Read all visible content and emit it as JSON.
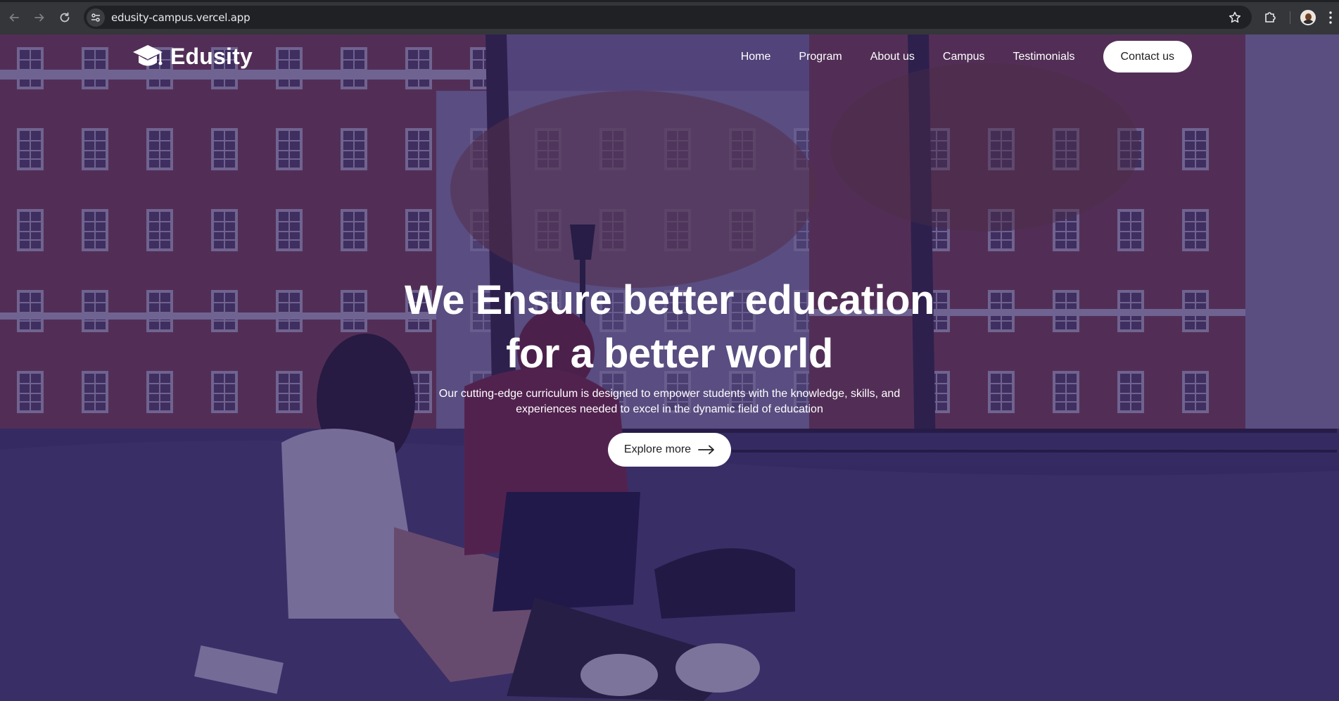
{
  "browser": {
    "url": "edusity-campus.vercel.app",
    "icons": {
      "back": "arrow-left-icon",
      "forward": "arrow-right-icon",
      "reload": "reload-icon",
      "site_info": "tune-icon",
      "bookmark": "star-icon",
      "extensions": "puzzle-icon",
      "profile": "avatar",
      "menu": "kebab-menu-icon"
    }
  },
  "site": {
    "logo_text": "Edusity",
    "logo_icon": "graduation-cap-icon",
    "nav": {
      "home": "Home",
      "program": "Program",
      "about": "About us",
      "campus": "Campus",
      "testimonials": "Testimonials",
      "contact": "Contact us"
    },
    "hero": {
      "title_line1": "We Ensure better education",
      "title_line2": "for a better world",
      "subtitle": "Our cutting-edge curriculum is designed to empower students with the knowledge, skills, and experiences needed to excel in the dynamic field of education",
      "cta_label": "Explore more",
      "cta_icon": "arrow-right-icon"
    }
  },
  "colors": {
    "overlay": "#241858",
    "chrome_bg": "#35363a",
    "omnibox_bg": "#202124",
    "button_bg": "#ffffff",
    "button_text": "#212121"
  }
}
